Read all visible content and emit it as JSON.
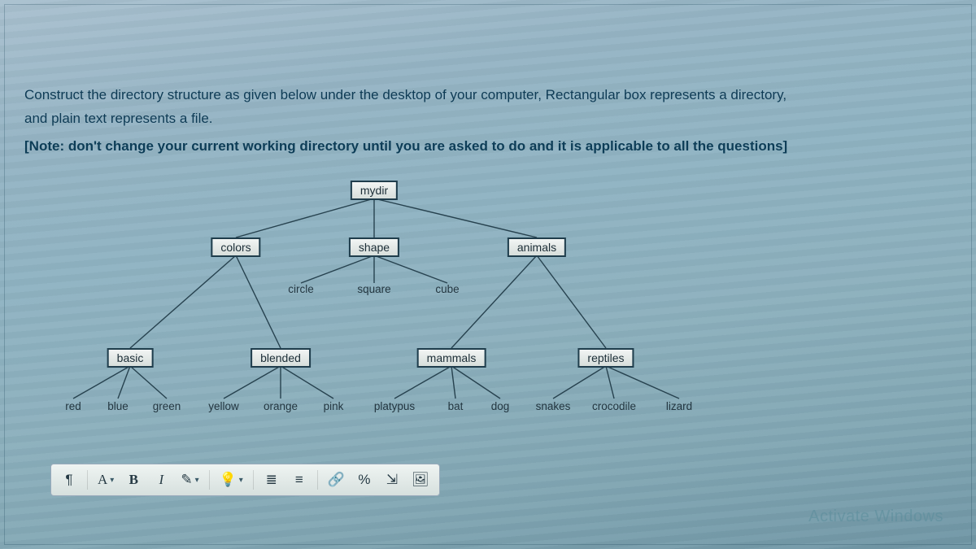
{
  "instructions": {
    "line1": "Construct the directory structure as given below under the desktop of your computer, Rectangular box represents a directory,",
    "line2": "and plain text represents a file.",
    "note": "[Note: don't change your current working directory until you are asked to do and it is applicable to all the questions]"
  },
  "tree": {
    "root": "mydir",
    "dirs": {
      "colors": "colors",
      "shape": "shape",
      "animals": "animals",
      "basic": "basic",
      "blended": "blended",
      "mammals": "mammals",
      "reptiles": "reptiles"
    },
    "files": {
      "circle": "circle",
      "square": "square",
      "cube": "cube",
      "red": "red",
      "blue": "blue",
      "green": "green",
      "yellow": "yellow",
      "orange": "orange",
      "pink": "pink",
      "platypus": "platypus",
      "bat": "bat",
      "dog": "dog",
      "snakes": "snakes",
      "crocodile": "crocodile",
      "lizard": "lizard"
    }
  },
  "toolbar": {
    "paragraph": "¶",
    "font": "A",
    "bold": "B",
    "italic": "I",
    "highlight": "✎",
    "insert": "💡",
    "bullets": "≣",
    "numbers": "≡",
    "link": "🔗",
    "code": "%",
    "embed": "⇲",
    "image": "🖼"
  },
  "watermark": "Activate Windows"
}
